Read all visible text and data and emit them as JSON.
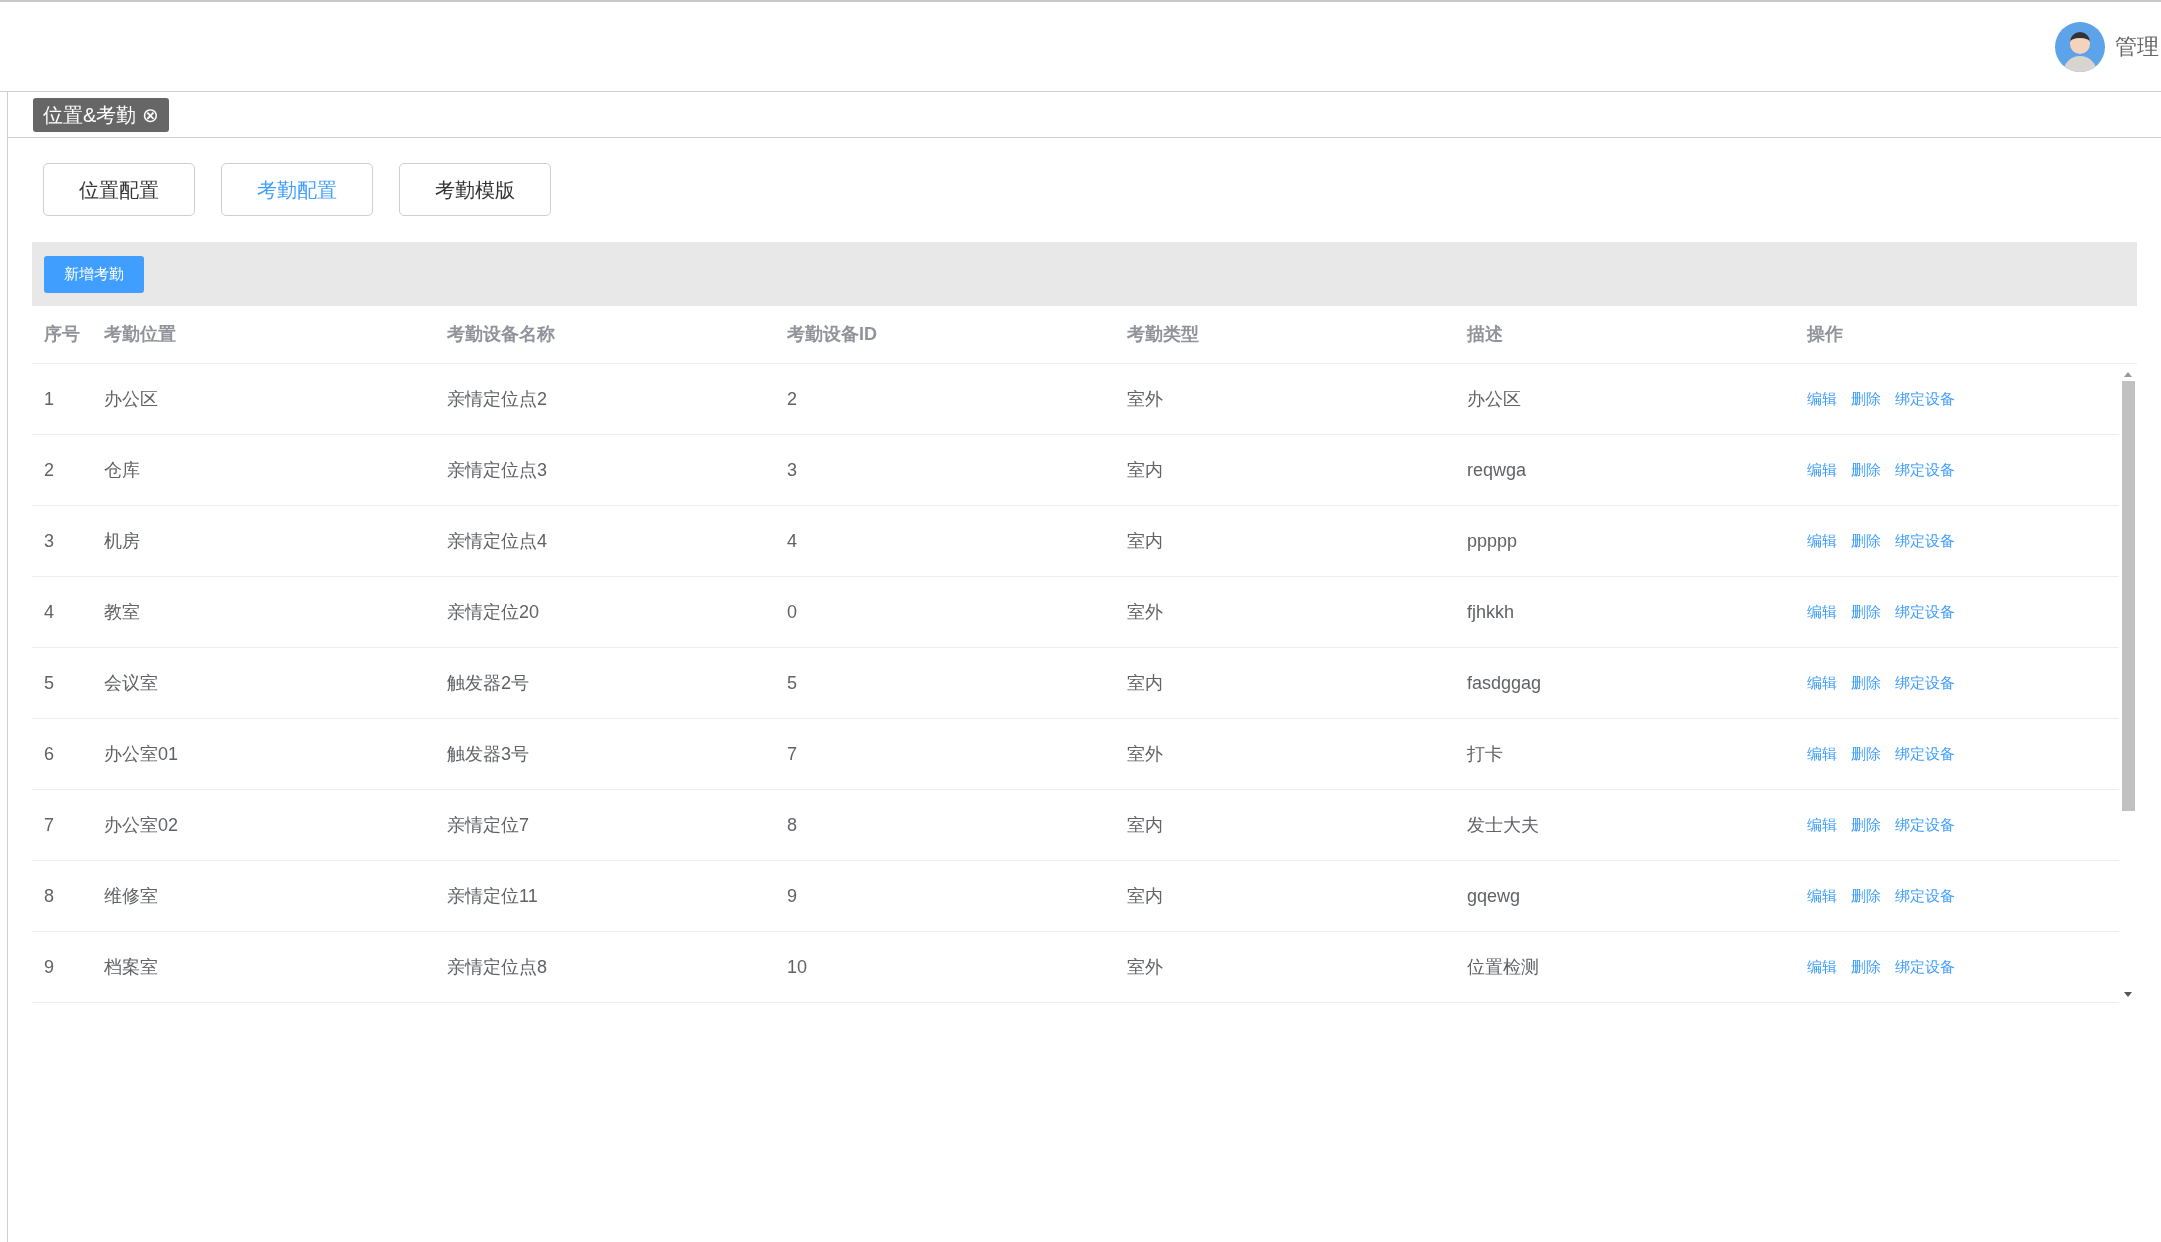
{
  "header": {
    "user_name": "管理"
  },
  "page_tabs": [
    {
      "label": "位置&考勤",
      "close": "⊗"
    }
  ],
  "sub_tabs": [
    {
      "label": "位置配置",
      "selected": false
    },
    {
      "label": "考勤配置",
      "selected": true
    },
    {
      "label": "考勤模版",
      "selected": false
    }
  ],
  "toolbar": {
    "add_button": "新增考勤"
  },
  "table": {
    "columns": [
      "序号",
      "考勤位置",
      "考勤设备名称",
      "考勤设备ID",
      "考勤类型",
      "描述",
      "操作"
    ],
    "rows": [
      {
        "cells": [
          "1",
          "办公区",
          "亲情定位点2",
          "2",
          "室外",
          "办公区"
        ],
        "actions": [
          "编辑",
          "删除",
          "绑定设备"
        ]
      },
      {
        "cells": [
          "2",
          "仓库",
          "亲情定位点3",
          "3",
          "室内",
          "reqwga"
        ],
        "actions": [
          "编辑",
          "删除",
          "绑定设备"
        ]
      },
      {
        "cells": [
          "3",
          "机房",
          "亲情定位点4",
          "4",
          "室内",
          "ppppp"
        ],
        "actions": [
          "编辑",
          "删除",
          "绑定设备"
        ]
      },
      {
        "cells": [
          "4",
          "教室",
          "亲情定位20",
          "0",
          "室外",
          "fjhkkh"
        ],
        "actions": [
          "编辑",
          "删除",
          "绑定设备"
        ]
      },
      {
        "cells": [
          "5",
          "会议室",
          "触发器2号",
          "5",
          "室内",
          "fasdggag"
        ],
        "actions": [
          "编辑",
          "删除",
          "绑定设备"
        ]
      },
      {
        "cells": [
          "6",
          "办公室01",
          "触发器3号",
          "7",
          "室外",
          "打卡"
        ],
        "actions": [
          "编辑",
          "删除",
          "绑定设备"
        ]
      },
      {
        "cells": [
          "7",
          "办公室02",
          "亲情定位7",
          "8",
          "室内",
          "发士大夫"
        ],
        "actions": [
          "编辑",
          "删除",
          "绑定设备"
        ]
      },
      {
        "cells": [
          "8",
          "维修室",
          "亲情定位11",
          "9",
          "室内",
          "gqewg"
        ],
        "actions": [
          "编辑",
          "删除",
          "绑定设备"
        ]
      },
      {
        "cells": [
          "9",
          "档案室",
          "亲情定位点8",
          "10",
          "室外",
          "位置检测"
        ],
        "actions": [
          "编辑",
          "删除",
          "绑定设备"
        ]
      }
    ]
  }
}
